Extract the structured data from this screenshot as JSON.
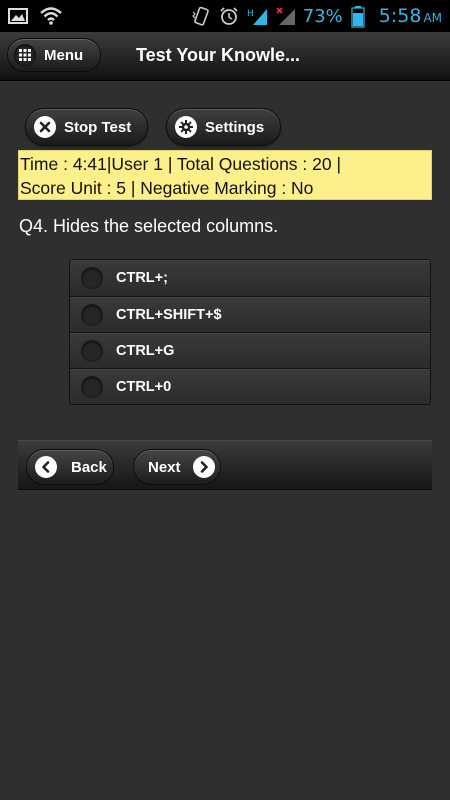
{
  "status_bar": {
    "battery_percent": "73%",
    "time": "5:58",
    "ampm": "AM",
    "icons": [
      "image-icon",
      "wifi-icon",
      "vibrate-icon",
      "alarm-icon",
      "hspa-signal-icon",
      "no-signal-icon",
      "battery-icon"
    ]
  },
  "header": {
    "menu_label": "Menu",
    "title": "Test Your Knowle..."
  },
  "toolbar": {
    "stop_label": "Stop Test",
    "settings_label": "Settings"
  },
  "info": {
    "line1": "Time : 4:41|User 1 | Total Questions : 20 |",
    "line2": "Score Unit : 5 | Negative Marking : No"
  },
  "question": {
    "text": "Q4. Hides the selected columns."
  },
  "options": [
    {
      "label": "CTRL+;"
    },
    {
      "label": "CTRL+SHIFT+$"
    },
    {
      "label": "CTRL+G"
    },
    {
      "label": "CTRL+0"
    }
  ],
  "nav": {
    "back_label": "Back",
    "next_label": "Next"
  },
  "colors": {
    "background": "#2f2f2f",
    "status_accent": "#33b5e5",
    "info_bg": "#fdf08a"
  }
}
